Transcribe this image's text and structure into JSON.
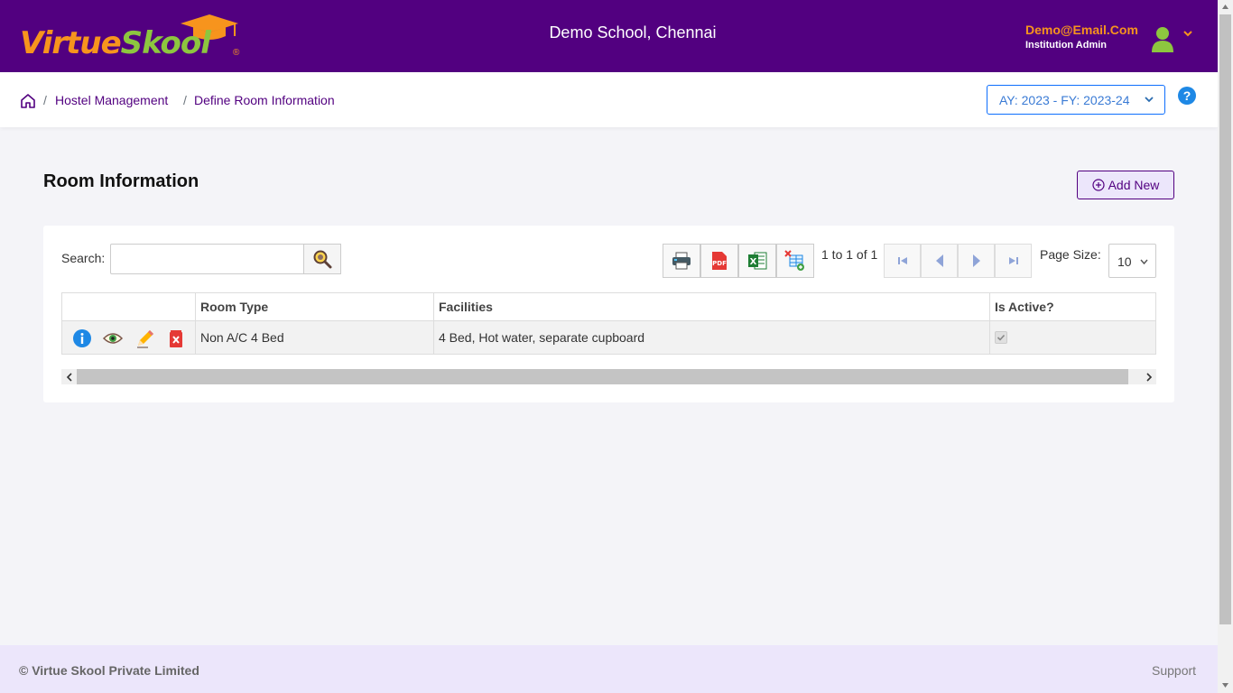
{
  "header": {
    "logo_part1": "Virtue",
    "logo_part2": "Skool",
    "logo_reg": "®",
    "school_name": "Demo School, Chennai",
    "user_email": "Demo@Email.Com",
    "user_role": "Institution Admin"
  },
  "breadcrumb": {
    "items": [
      "Hostel Management",
      "Define Room Information"
    ],
    "separator": "/"
  },
  "academic_year": "AY: 2023 - FY: 2023-24",
  "help_label": "?",
  "page": {
    "title": "Room Information",
    "add_new_label": "Add New"
  },
  "toolbar": {
    "search_label": "Search:",
    "search_value": "",
    "pager_text": "1 to 1 of 1",
    "page_size_label": "Page Size:",
    "page_size_value": "10"
  },
  "grid": {
    "columns": [
      "",
      "Room Type",
      "Facilities",
      "Is Active?"
    ],
    "rows": [
      {
        "room_type": "Non A/C 4 Bed",
        "facilities": "4 Bed, Hot water, separate cupboard",
        "is_active": true
      }
    ]
  },
  "footer": {
    "copyright": "© Virtue Skool Private Limited",
    "support": "Support"
  },
  "colors": {
    "brand_purple": "#520080",
    "brand_orange": "#f7941d",
    "brand_green": "#8dc63f",
    "accent_blue": "#0d6efd"
  }
}
